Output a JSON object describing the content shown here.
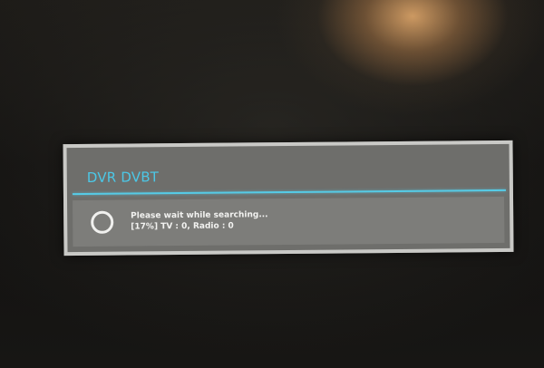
{
  "dialog": {
    "title": "DVR DVBT",
    "message": "Please wait while searching...",
    "status": "[17%] TV : 0, Radio : 0",
    "accent_color": "#4cc7e6"
  },
  "icons": {
    "spinner": "progress-spinner-icon"
  }
}
